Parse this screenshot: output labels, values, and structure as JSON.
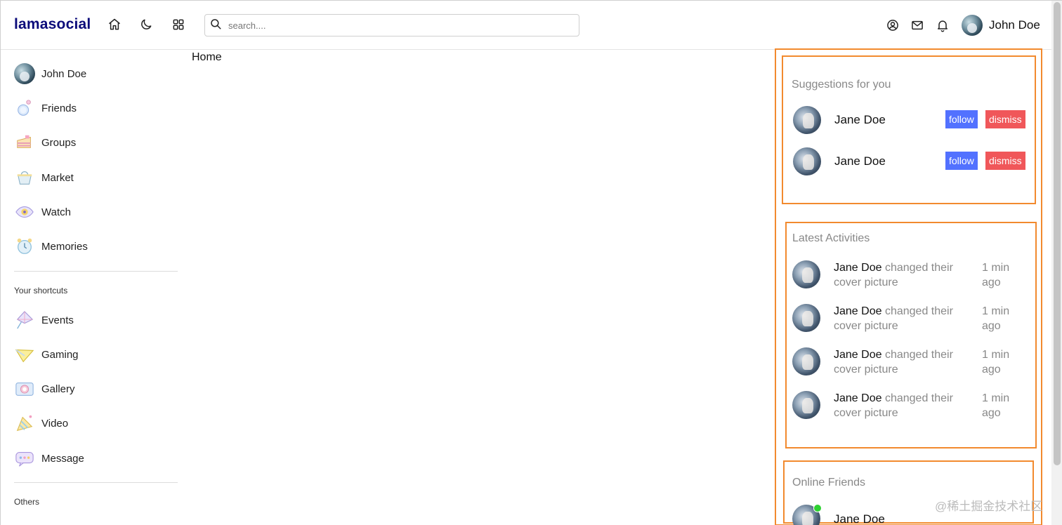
{
  "navbar": {
    "logo": "lamasocial",
    "search_placeholder": "search....",
    "user_name": "John Doe",
    "icons": [
      "home-icon",
      "moon-icon",
      "grid-icon",
      "user-circle-icon",
      "mail-icon",
      "bell-icon"
    ]
  },
  "leftbar": {
    "items": [
      {
        "label": "John Doe",
        "icon": "avatar"
      },
      {
        "label": "Friends",
        "icon": "friends-icon"
      },
      {
        "label": "Groups",
        "icon": "groups-icon"
      },
      {
        "label": "Market",
        "icon": "market-icon"
      },
      {
        "label": "Watch",
        "icon": "watch-icon"
      },
      {
        "label": "Memories",
        "icon": "memories-icon"
      }
    ],
    "shortcuts_title": "Your shortcuts",
    "shortcuts": [
      {
        "label": "Events",
        "icon": "events-icon"
      },
      {
        "label": "Gaming",
        "icon": "gaming-icon"
      },
      {
        "label": "Gallery",
        "icon": "gallery-icon"
      },
      {
        "label": "Video",
        "icon": "video-icon"
      },
      {
        "label": "Message",
        "icon": "message-icon"
      }
    ],
    "others_title": "Others"
  },
  "main": {
    "title": "Home"
  },
  "rightbar": {
    "suggestions": {
      "title": "Suggestions for you",
      "items": [
        {
          "name": "Jane Doe",
          "follow": "follow",
          "dismiss": "dismiss"
        },
        {
          "name": "Jane Doe",
          "follow": "follow",
          "dismiss": "dismiss"
        }
      ]
    },
    "activities": {
      "title": "Latest Activities",
      "items": [
        {
          "name": "Jane Doe",
          "text": " changed their cover picture",
          "time": "1 min ago"
        },
        {
          "name": "Jane Doe",
          "text": " changed their cover picture",
          "time": "1 min ago"
        },
        {
          "name": "Jane Doe",
          "text": " changed their cover picture",
          "time": "1 min ago"
        },
        {
          "name": "Jane Doe",
          "text": " changed their cover picture",
          "time": "1 min ago"
        }
      ]
    },
    "online": {
      "title": "Online Friends",
      "items": [
        {
          "name": "Jane Doe"
        }
      ]
    }
  },
  "watermark": "@稀土掘金技术社区",
  "colors": {
    "accent_border": "#f28a2e",
    "follow": "#5271ff",
    "dismiss": "#f0575a",
    "online": "#2ed132",
    "logo": "#0b0b7a"
  }
}
